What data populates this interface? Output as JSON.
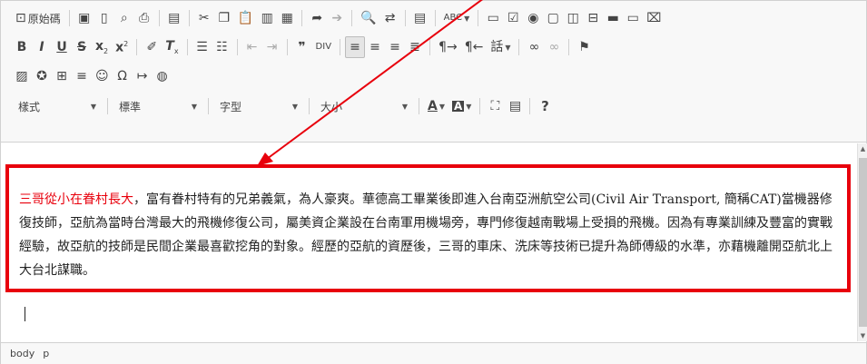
{
  "toolbar": {
    "source_label": "原始碼",
    "style_combo": "樣式",
    "format_combo": "標準",
    "font_combo": "字型",
    "size_combo": "大小",
    "font_color_letter": "A",
    "bg_color_letter": "A",
    "bold_letter": "B",
    "italic_letter": "I",
    "underline_letter": "U",
    "strike_letter": "S",
    "language_label": "話",
    "help_label": "?"
  },
  "content": {
    "highlight": "三哥從小在眷村長大",
    "body": "，富有眷村特有的兄弟義氣，為人豪爽。華德高工畢業後即進入台南亞洲航空公司(Civil Air Transport, 簡稱CAT)當機器修復技師，亞航為當時台灣最大的飛機修復公司，屬美資企業設在台南軍用機場旁，專門修復越南戰場上受損的飛機。因為有專業訓練及豐富的實戰經驗，故亞航的技師是民間企業最喜歡挖角的對象。經歷的亞航的資歷後，三哥的車床、洗床等技術已提升為師傅級的水準，亦藉機離開亞航北上大台北謀職。"
  },
  "statusbar": {
    "path": [
      "body",
      "p"
    ]
  },
  "colors": {
    "annotation": "#e8000c",
    "toolbar_bg": "#f8f8f8",
    "border": "#d1d1d1"
  }
}
